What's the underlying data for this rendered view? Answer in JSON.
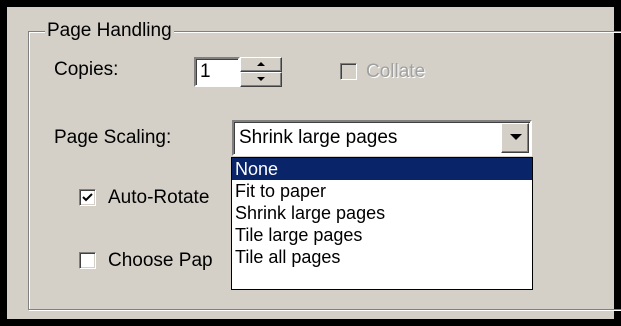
{
  "group": {
    "title": "Page Handling"
  },
  "copies": {
    "label": "Copies:",
    "value": "1"
  },
  "collate": {
    "label": "Collate",
    "checked": false,
    "enabled": false
  },
  "page_scaling": {
    "label": "Page Scaling:",
    "selected": "Shrink large pages",
    "options": [
      "None",
      "Fit to paper",
      "Shrink large pages",
      "Tile large pages",
      "Tile all pages"
    ],
    "highlighted": "None"
  },
  "auto_rotate": {
    "label": "Auto-Rotate",
    "checked": true
  },
  "choose_paper": {
    "label": "Choose Pap",
    "checked": false
  },
  "colors": {
    "face": "#d4d0c8",
    "highlight": "#0a246a",
    "frame": "#000000"
  }
}
